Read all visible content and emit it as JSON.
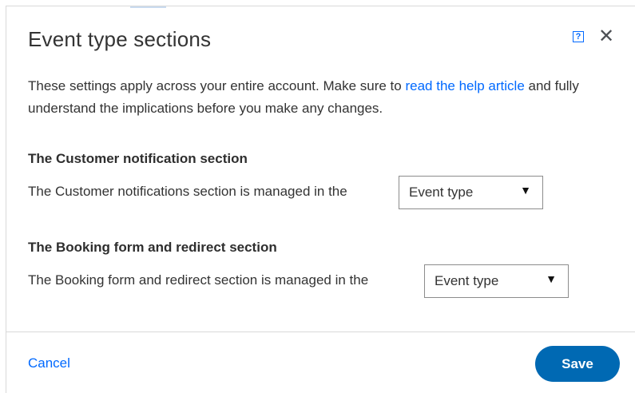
{
  "dialog": {
    "title": "Event type sections",
    "help_icon_label": "?",
    "close_icon_label": "✕"
  },
  "intro": {
    "text_before_link": "These settings apply across your entire account. Make sure to ",
    "link_text": "read the help article",
    "text_after_link": " and fully understand the implications before you make any changes."
  },
  "sections": [
    {
      "title": "The Customer notification section",
      "text": "The Customer notifications section is managed in the",
      "select_value": "Event type"
    },
    {
      "title": "The Booking form and redirect section",
      "text": "The Booking form and redirect section is managed in the",
      "select_value": "Event type"
    }
  ],
  "footer": {
    "cancel_label": "Cancel",
    "save_label": "Save"
  },
  "colors": {
    "link": "#0069ff",
    "primary_button": "#0069b3",
    "text": "#333333",
    "divider": "#d9d9d9"
  },
  "icons": {
    "caret": "▼"
  }
}
